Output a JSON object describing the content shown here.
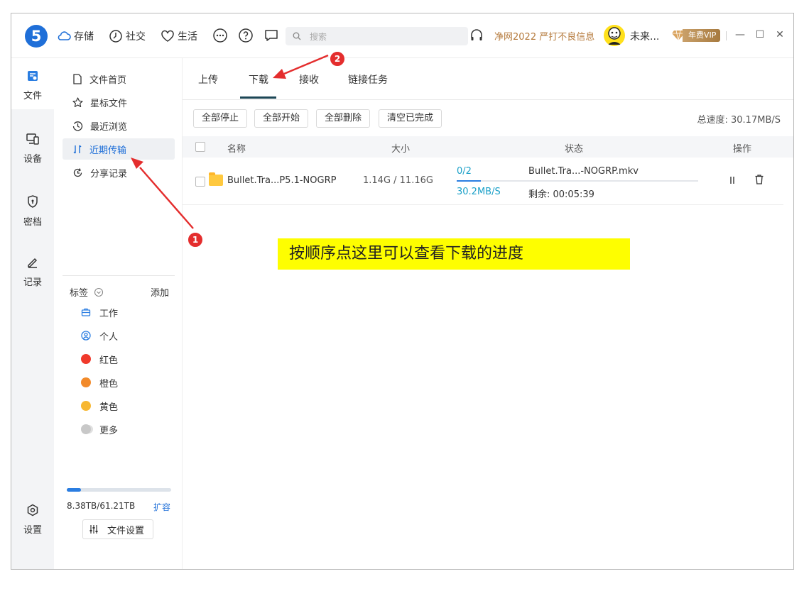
{
  "app": {
    "logo_text": "5"
  },
  "topnav": {
    "storage": "存储",
    "social": "社交",
    "life": "生活",
    "search_placeholder": "搜索",
    "promo": "净网2022 严打不良信息",
    "username": "未来...",
    "vip_label": "年费VIP"
  },
  "rail": {
    "files": "文件",
    "devices": "设备",
    "vault": "密档",
    "notes": "记录",
    "settings": "设置"
  },
  "sidebar": {
    "items": [
      "文件首页",
      "星标文件",
      "最近浏览",
      "近期传输",
      "分享记录"
    ],
    "tags_title": "标签",
    "tags_add": "添加",
    "tags": [
      {
        "label": "工作"
      },
      {
        "label": "个人"
      },
      {
        "label": "红色",
        "color": "#f0392b"
      },
      {
        "label": "橙色",
        "color": "#f28a2a"
      },
      {
        "label": "黄色",
        "color": "#f7b731"
      },
      {
        "label": "更多",
        "color": "#c8c8c8"
      }
    ],
    "storage_text": "8.38TB/61.21TB",
    "storage_used_fraction": 0.137,
    "expand": "扩容",
    "file_settings": "文件设置"
  },
  "main": {
    "tabs": [
      "上传",
      "下载",
      "接收",
      "链接任务"
    ],
    "active_tab": "下载",
    "toolbar": [
      "全部停止",
      "全部开始",
      "全部删除",
      "清空已完成"
    ],
    "total_speed": "总速度: 30.17MB/S",
    "columns": [
      "名称",
      "大小",
      "状态",
      "操作"
    ],
    "row": {
      "name": "Bullet.Tra...P5.1-NOGRP",
      "size": "1.14G / 11.16G",
      "count": "0/2",
      "progress_fraction": 0.1,
      "rate": "30.2MB/S",
      "file": "Bullet.Tra...-NOGRP.mkv",
      "remaining": "剩余: 00:05:39"
    }
  },
  "annotation": {
    "note": "按顺序点这里可以查看下载的进度",
    "marker1": "1",
    "marker2": "2",
    "color": "#e42d2d"
  }
}
